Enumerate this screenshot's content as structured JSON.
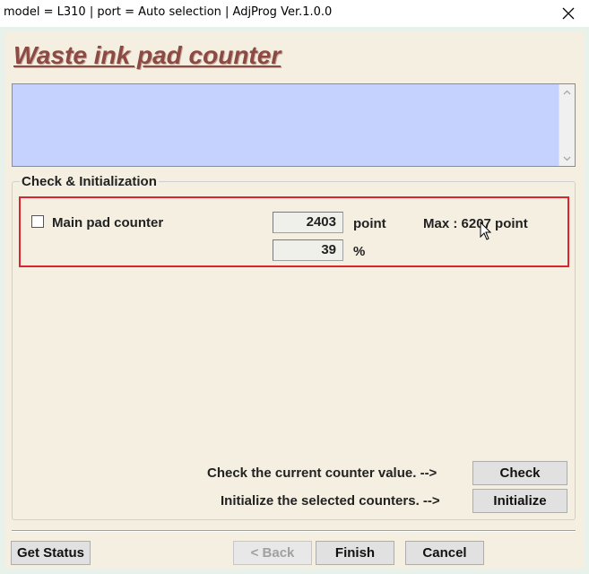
{
  "window": {
    "title": "model = L310 | port = Auto selection | AdjProg Ver.1.0.0",
    "close_icon": "close-icon"
  },
  "page": {
    "heading": "Waste ink pad counter",
    "info_box_text": ""
  },
  "group": {
    "title": "Check & Initialization",
    "counter": {
      "label": "Main pad counter",
      "checked": false,
      "points_value": "2403",
      "points_unit": "point",
      "percent_value": "39",
      "percent_unit": "%",
      "max_text": "Max : 6207 point"
    },
    "highlight_color": "#d9252b"
  },
  "actions": {
    "check_hint": "Check the current counter value. -->",
    "check_button": "Check",
    "init_hint": "Initialize the selected counters. -->",
    "init_button": "Initialize"
  },
  "footer": {
    "get_status": "Get Status",
    "back": "< Back",
    "finish": "Finish",
    "cancel": "Cancel"
  },
  "colors": {
    "heading": "#8b4a42",
    "info_box": "#c6d2fe",
    "panel": "#f4efe0"
  }
}
